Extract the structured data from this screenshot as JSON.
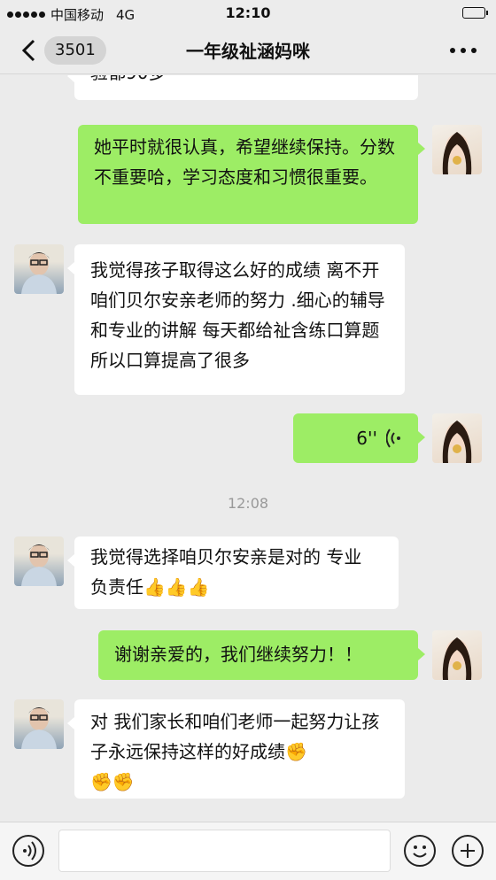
{
  "status_bar": {
    "carrier": "中国移动",
    "network": "4G",
    "time": "12:10"
  },
  "header": {
    "back_count": "3501",
    "title": "一年级祉涵妈咪"
  },
  "messages": [
    {
      "side": "left",
      "text": "验都90多"
    },
    {
      "side": "right",
      "text": "她平时就很认真，希望继续保持。分数不重要哈，学习态度和习惯很重要。"
    },
    {
      "side": "left",
      "text": "我觉得孩子取得这么好的成绩 离不开咱们贝尔安亲老师的努力 .细心的辅导和专业的讲解 每天都给祉含练口算题 所以口算提高了很多"
    },
    {
      "side": "right",
      "type": "voice",
      "duration": "6''"
    },
    {
      "type": "time",
      "text": "12:08"
    },
    {
      "side": "left",
      "text": "我觉得选择咱贝尔安亲是对的 专业 负责任",
      "emoji": "👍👍👍"
    },
    {
      "side": "right",
      "text": "谢谢亲爱的，我们继续努力！！"
    },
    {
      "side": "left",
      "text": "对 我们家长和咱们老师一起努力让孩子永远保持这样的好成绩",
      "emoji_end": "✊",
      "emoji_line": "✊✊"
    }
  ],
  "colors": {
    "right_bubble": "#9ded65",
    "left_bubble": "#ffffff",
    "background": "#ebebeb"
  }
}
